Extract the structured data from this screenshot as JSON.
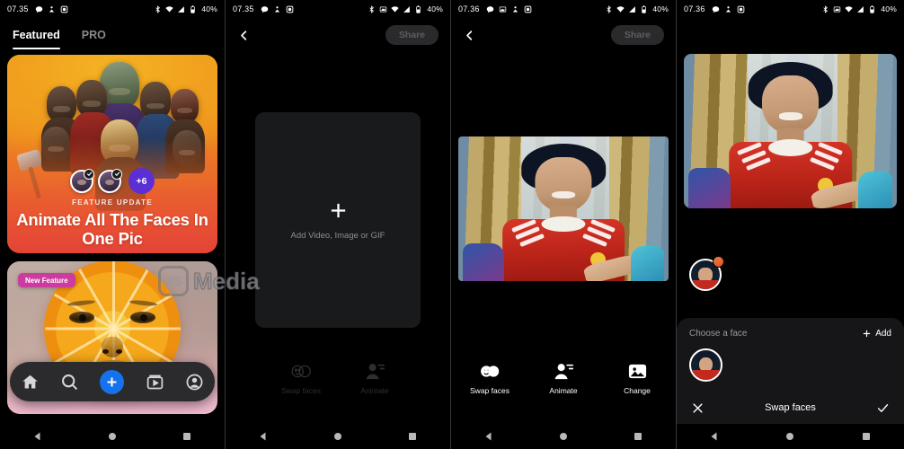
{
  "panels": [
    {
      "id": "home-feed",
      "status": {
        "time": "07.35",
        "battery": "40%"
      },
      "tabs": [
        {
          "label": "Featured",
          "active": true
        },
        {
          "label": "PRO",
          "active": false
        }
      ],
      "cards": [
        {
          "eyebrow": "FEATURE UPDATE",
          "title": "Animate All The Faces In One Pic",
          "more_count": "+6"
        },
        {
          "badge": "New Feature"
        }
      ],
      "bottom_nav": [
        {
          "icon": "home-icon",
          "label": "Home"
        },
        {
          "icon": "search-icon",
          "label": "Search"
        },
        {
          "icon": "plus-icon",
          "label": "Create"
        },
        {
          "icon": "video-library-icon",
          "label": "Library"
        },
        {
          "icon": "profile-icon",
          "label": "Profile"
        }
      ]
    },
    {
      "id": "editor-empty",
      "status": {
        "time": "07.35",
        "battery": "40%"
      },
      "header": {
        "back": "back-icon",
        "share_label": "Share",
        "share_enabled": false
      },
      "dropzone": {
        "plus": "plus-icon",
        "text": "Add Video, Image or GIF"
      },
      "tools": [
        {
          "label": "Swap faces",
          "icon": "swap-faces-icon",
          "enabled": false
        },
        {
          "label": "Animate",
          "icon": "animate-icon",
          "enabled": false
        }
      ]
    },
    {
      "id": "editor-with-photo",
      "status": {
        "time": "07.36",
        "battery": "40%"
      },
      "header": {
        "back": "back-icon",
        "share_label": "Share",
        "share_enabled": false
      },
      "tools": [
        {
          "label": "Swap faces",
          "icon": "swap-faces-icon",
          "enabled": true
        },
        {
          "label": "Animate",
          "icon": "animate-icon",
          "enabled": true
        },
        {
          "label": "Change",
          "icon": "change-image-icon",
          "enabled": true
        }
      ]
    },
    {
      "id": "swap-faces-sheet",
      "status": {
        "time": "07.36",
        "battery": "40%"
      },
      "sheet": {
        "title": "Choose a face",
        "add_label": "Add",
        "action_label": "Swap faces",
        "cancel": "close-icon",
        "confirm": "check-icon"
      }
    }
  ],
  "watermark": {
    "mark": "JS",
    "text": "Media"
  },
  "android_nav": [
    {
      "icon": "back-triangle-icon"
    },
    {
      "icon": "home-circle-icon"
    },
    {
      "icon": "recents-square-icon"
    }
  ],
  "colors": {
    "accent_blue": "#1672ec",
    "badge_pink": "#cc3ba0",
    "avatar_purple": "#5b2fd4"
  }
}
